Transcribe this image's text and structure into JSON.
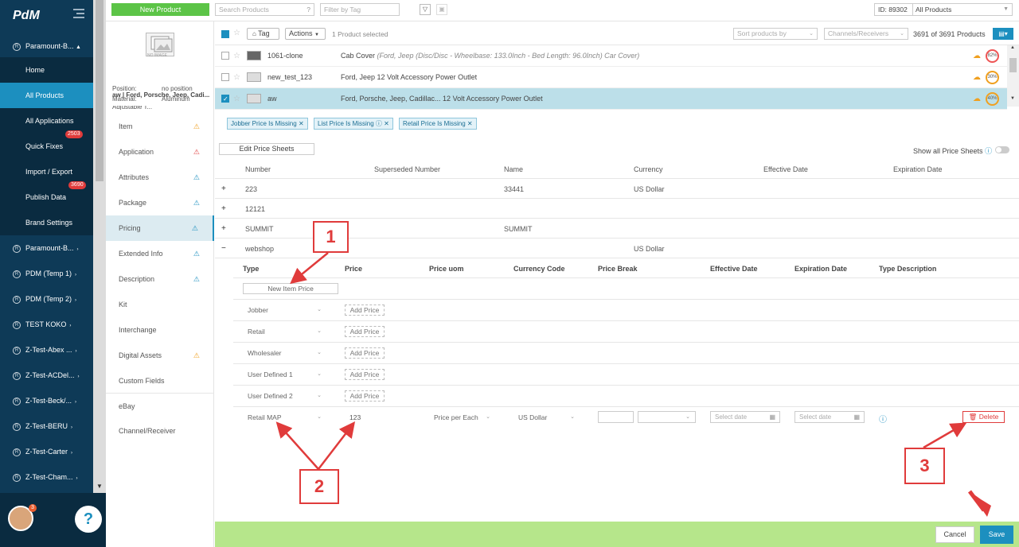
{
  "app": {
    "logo": "PdM"
  },
  "nav": {
    "current_brand": "Paramount-B...",
    "sub_items": [
      {
        "label": "Home"
      },
      {
        "label": "All Products"
      },
      {
        "label": "All Applications"
      },
      {
        "label": "Quick Fixes",
        "badge": "2503"
      },
      {
        "label": "Import / Export"
      },
      {
        "label": "Publish Data",
        "badge": "3690"
      },
      {
        "label": "Brand Settings"
      }
    ],
    "brands": [
      "Paramount-B...",
      "PDM (Temp 1)",
      "PDM (Temp 2)",
      "TEST KOKO",
      "Z-Test-Abex ...",
      "Z-Test-ACDel...",
      "Z-Test-Beck/...",
      "Z-Test-BERU",
      "Z-Test-Carter",
      "Z-Test-Cham...",
      "Z-Test-Cham..."
    ],
    "avatar_badge": "3",
    "help_label": "?"
  },
  "topbar": {
    "new_product_label": "New Product",
    "search_placeholder": "Search Products",
    "tag_filter_placeholder": "Filter by Tag",
    "id_label": "ID: 89302",
    "scope_select": "All Products"
  },
  "product_card": {
    "image_label": "NO IMAGE",
    "title": "aw | Ford, Porsche, Jeep, Cadi...",
    "position_label": "Position:",
    "position_value": "no position",
    "material_label": "Material:",
    "material_value": "Aluminum",
    "cut_text": "Adjustable T..."
  },
  "list_toolbar": {
    "tag_label": "Tag",
    "actions_label": "Actions",
    "selected_text": "1 Product selected",
    "sort_label": "Sort products by",
    "channels_label": "Channels/Receivers",
    "count_text": "3691 of 3691 Products"
  },
  "products": [
    {
      "name": "1061-clone",
      "desc_main": "Cab Cover",
      "desc_detail": "(Ford, Jeep (Disc/Disc - Wheelbase: 133.0Inch - Bed Length: 96.0Inch) Car Cover)",
      "pct": "82%",
      "selected": false
    },
    {
      "name": "new_test_123",
      "desc_main": "Ford, Jeep 12 Volt Accessory Power Outlet",
      "desc_detail": "",
      "pct": "30%",
      "selected": false
    },
    {
      "name": "aw",
      "desc_main": "Ford, Porsche, Jeep, Cadillac... 12 Volt Accessory Power Outlet",
      "desc_detail": "",
      "pct": "40%",
      "selected": true
    }
  ],
  "side_tabs": [
    {
      "label": "Item",
      "warn": "orange"
    },
    {
      "label": "Application",
      "warn": "red"
    },
    {
      "label": "Attributes",
      "warn": "blue"
    },
    {
      "label": "Package",
      "warn": "blue"
    },
    {
      "label": "Pricing",
      "warn": "blue"
    },
    {
      "label": "Extended Info",
      "warn": "blue"
    },
    {
      "label": "Description",
      "warn": "blue"
    },
    {
      "label": "Kit",
      "warn": ""
    },
    {
      "label": "Interchange",
      "warn": ""
    },
    {
      "label": "Digital Assets",
      "warn": "orange"
    },
    {
      "label": "Custom Fields",
      "warn": ""
    },
    {
      "label": "eBay",
      "warn": ""
    },
    {
      "label": "Channel/Receiver",
      "warn": ""
    }
  ],
  "chips": [
    "Jobber Price Is Missing",
    "List Price Is Missing",
    "Retail Price Is Missing"
  ],
  "pricing": {
    "edit_sheets_label": "Edit Price Sheets",
    "show_all_label": "Show all Price Sheets",
    "sheet_headers": [
      "Number",
      "Superseded Number",
      "Name",
      "Currency",
      "Effective Date",
      "Expiration Date"
    ],
    "sheets": [
      {
        "toggle": "+",
        "number": "223",
        "superseded": "",
        "name": "33441",
        "currency": "US Dollar"
      },
      {
        "toggle": "+",
        "number": "12121",
        "superseded": "",
        "name": "",
        "currency": ""
      },
      {
        "toggle": "+",
        "number": "SUMMIT",
        "superseded": "",
        "name": "SUMMIT",
        "currency": ""
      },
      {
        "toggle": "−",
        "number": "webshop",
        "superseded": "",
        "name": "",
        "currency": "US Dollar"
      }
    ],
    "price_headers": [
      "Type",
      "Price",
      "Price uom",
      "Currency Code",
      "Price Break",
      "Effective Date",
      "Expiration Date",
      "Type Description"
    ],
    "new_item_price_label": "New Item Price",
    "price_rows": [
      {
        "type": "Jobber",
        "add": "Add Price"
      },
      {
        "type": "Retail",
        "add": "Add Price"
      },
      {
        "type": "Wholesaler",
        "add": "Add Price"
      },
      {
        "type": "User Defined 1",
        "add": "Add Price"
      },
      {
        "type": "User Defined 2",
        "add": "Add Price"
      }
    ],
    "edit_row": {
      "type": "Retail MAP",
      "price": "123",
      "uom": "Price per Each",
      "currency": "US Dollar",
      "eff_placeholder": "Select date",
      "exp_placeholder": "Select date",
      "delete_label": "Delete"
    }
  },
  "annotations": [
    "1",
    "2",
    "3"
  ],
  "footer": {
    "cancel_label": "Cancel",
    "save_label": "Save"
  }
}
